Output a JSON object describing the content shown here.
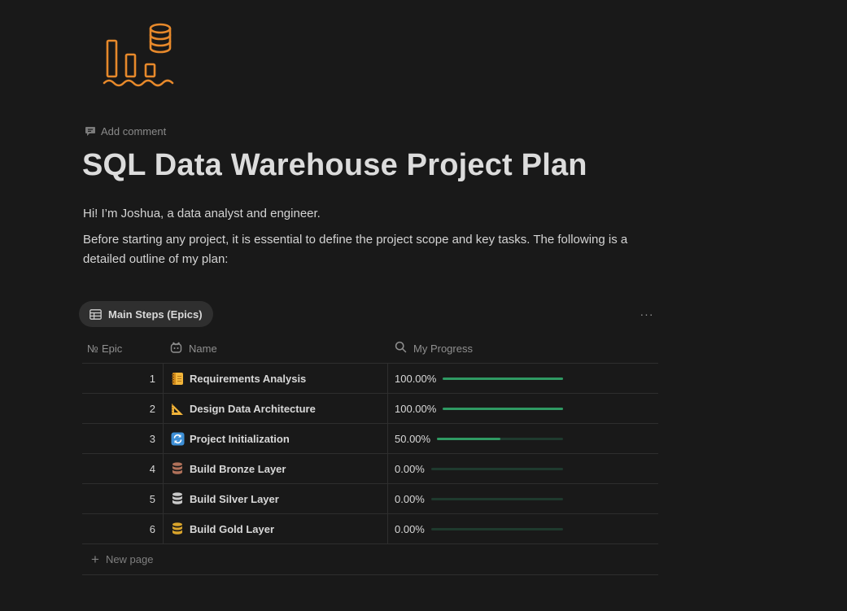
{
  "page": {
    "title": "SQL Data Warehouse Project Plan",
    "icon": "bar-chart-database-icon",
    "accent_color": "#e7892b"
  },
  "comment": {
    "label": "Add comment",
    "icon": "comment-icon"
  },
  "intro": {
    "line1": "Hi! I’m Joshua, a data analyst and engineer.",
    "line2": "Before starting any project, it is essential to define the project scope and key tasks. The following is a detailed outline of my plan:"
  },
  "database": {
    "view_tab": {
      "label": "Main Steps (Epics)",
      "icon": "table-icon"
    },
    "more_label": "···",
    "columns": {
      "epic": {
        "glyph": "№",
        "label": "Epic"
      },
      "name": {
        "label": "Name",
        "icon": "page-property-icon"
      },
      "progress": {
        "label": "My Progress",
        "icon": "search-icon"
      }
    },
    "rows": [
      {
        "epic": "1",
        "name": "Requirements Analysis",
        "icon": "notebook-icon",
        "progress_text": "100.00%",
        "progress": 1.0
      },
      {
        "epic": "2",
        "name": "Design Data Architecture",
        "icon": "triangular-ruler-icon",
        "progress_text": "100.00%",
        "progress": 1.0
      },
      {
        "epic": "3",
        "name": "Project Initialization",
        "icon": "arrows-refresh-icon",
        "progress_text": "50.00%",
        "progress": 0.5
      },
      {
        "epic": "4",
        "name": "Build Bronze Layer",
        "icon": "database-bronze-icon",
        "progress_text": "0.00%",
        "progress": 0.0
      },
      {
        "epic": "5",
        "name": "Build Silver Layer",
        "icon": "database-silver-icon",
        "progress_text": "0.00%",
        "progress": 0.0
      },
      {
        "epic": "6",
        "name": "Build Gold Layer",
        "icon": "database-gold-icon",
        "progress_text": "0.00%",
        "progress": 0.0
      }
    ],
    "new_page_label": "New page",
    "progress_color": "#2f9a63",
    "progress_track_color": "#1f3a2e"
  }
}
